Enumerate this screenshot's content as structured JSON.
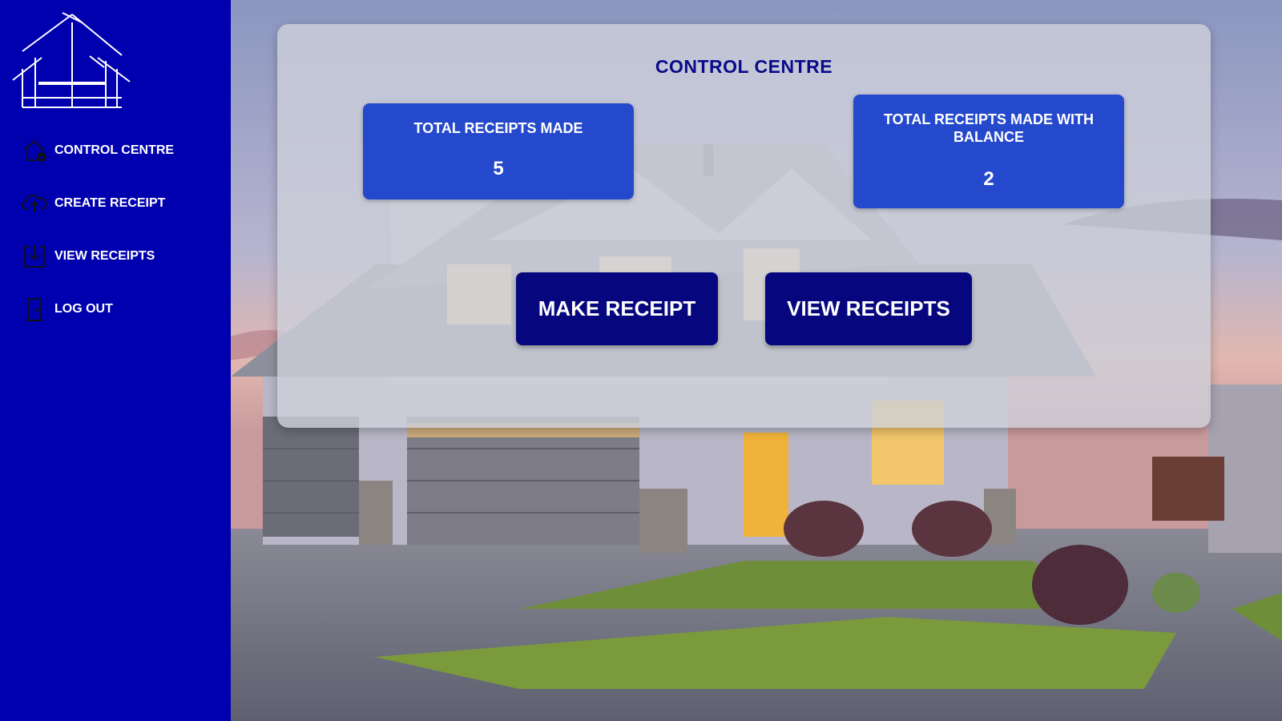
{
  "brand": {
    "logo_icon": "house-outline-logo-icon",
    "color": "#0000af"
  },
  "sidebar": {
    "items": [
      {
        "label": "CONTROL CENTRE",
        "icon": "home-check-icon"
      },
      {
        "label": "CREATE RECEIPT",
        "icon": "cloud-upload-icon"
      },
      {
        "label": "VIEW RECEIPTS",
        "icon": "download-box-icon"
      },
      {
        "label": "LOG OUT",
        "icon": "door-exit-icon"
      }
    ]
  },
  "dashboard": {
    "title": "CONTROL CENTRE",
    "stats": [
      {
        "title": "TOTAL RECEIPTS MADE",
        "value": "5"
      },
      {
        "title": "TOTAL RECEIPTS MADE WITH BALANCE",
        "value": "2"
      }
    ],
    "actions": {
      "make_receipt": "MAKE RECEIPT",
      "view_receipts": "VIEW RECEIPTS"
    }
  },
  "colors": {
    "sidebar": "#0000af",
    "stat_card": "#2549cc",
    "action_button": "#06067e",
    "title_text": "#0a0a8a"
  }
}
